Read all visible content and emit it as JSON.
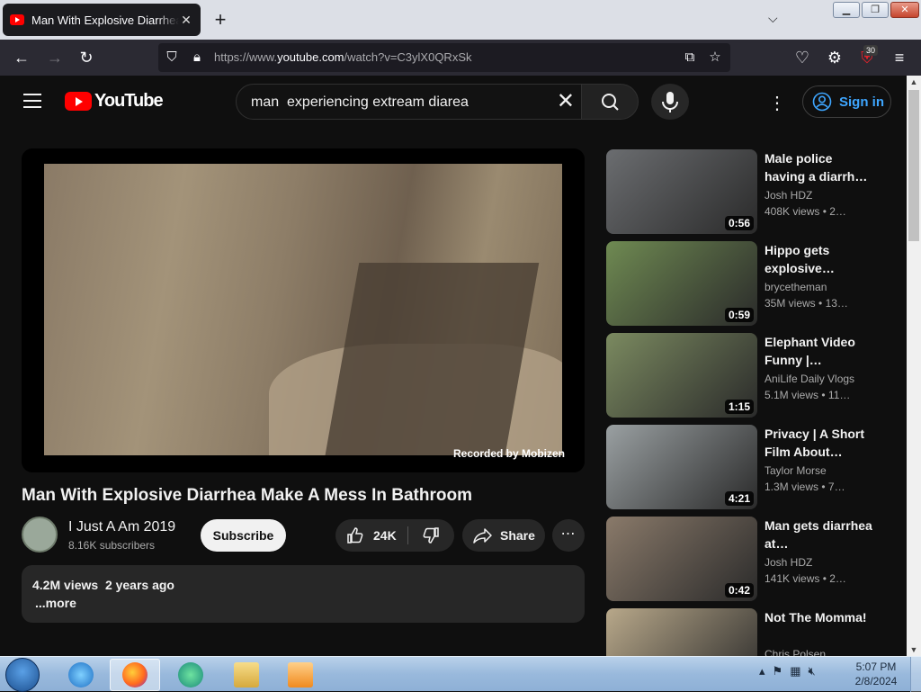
{
  "browser": {
    "tab_title": "Man With Explosive Diarrhea Make A Mess In Bathroom",
    "url_prefix": "https://www.",
    "url_host": "youtube.com",
    "url_path": "/watch?v=C3ylX0QRxSk",
    "extension_badge": "30"
  },
  "youtube": {
    "logo_text": "YouTube",
    "search_query": "man  experiencing extream diarea",
    "sign_in_label": "Sign in"
  },
  "video": {
    "overlay_text": "Recorded by Mobizen",
    "title": "Man With Explosive Diarrhea Make A Mess In Bathroom",
    "channel": "I Just A Am 2019",
    "subscribers": "8.16K subscribers",
    "subscribe_label": "Subscribe",
    "likes": "24K",
    "share_label": "Share",
    "views": "4.2M views",
    "age": "2 years ago",
    "more_label": "...more"
  },
  "related": [
    {
      "title": "Male police having a diarrh…",
      "channel": "Josh HDZ",
      "views": "408K views",
      "age": "2…",
      "duration": "0:56",
      "thumb_color": "#6b6d70"
    },
    {
      "title": "Hippo gets explosive…",
      "channel": "brycetheman",
      "views": "35M views",
      "age": "13…",
      "duration": "0:59",
      "thumb_color": "#6f8a52"
    },
    {
      "title": "Elephant Video Funny |…",
      "channel": "AniLife Daily Vlogs",
      "views": "5.1M views",
      "age": "11…",
      "duration": "1:15",
      "thumb_color": "#7b8a60"
    },
    {
      "title": "Privacy | A Short Film About…",
      "channel": "Taylor Morse",
      "views": "1.3M views",
      "age": "7…",
      "duration": "4:21",
      "thumb_color": "#9aa0a2"
    },
    {
      "title": "Man gets diarrhea at…",
      "channel": "Josh HDZ",
      "views": "141K views",
      "age": "2…",
      "duration": "0:42",
      "thumb_color": "#8a7a6a"
    },
    {
      "title": "Not The Momma!",
      "channel": "Chris Polsen",
      "views": "",
      "age": "",
      "duration": "",
      "thumb_color": "#b8a88a"
    }
  ],
  "taskbar": {
    "time": "5:07 PM",
    "date": "2/8/2024"
  }
}
